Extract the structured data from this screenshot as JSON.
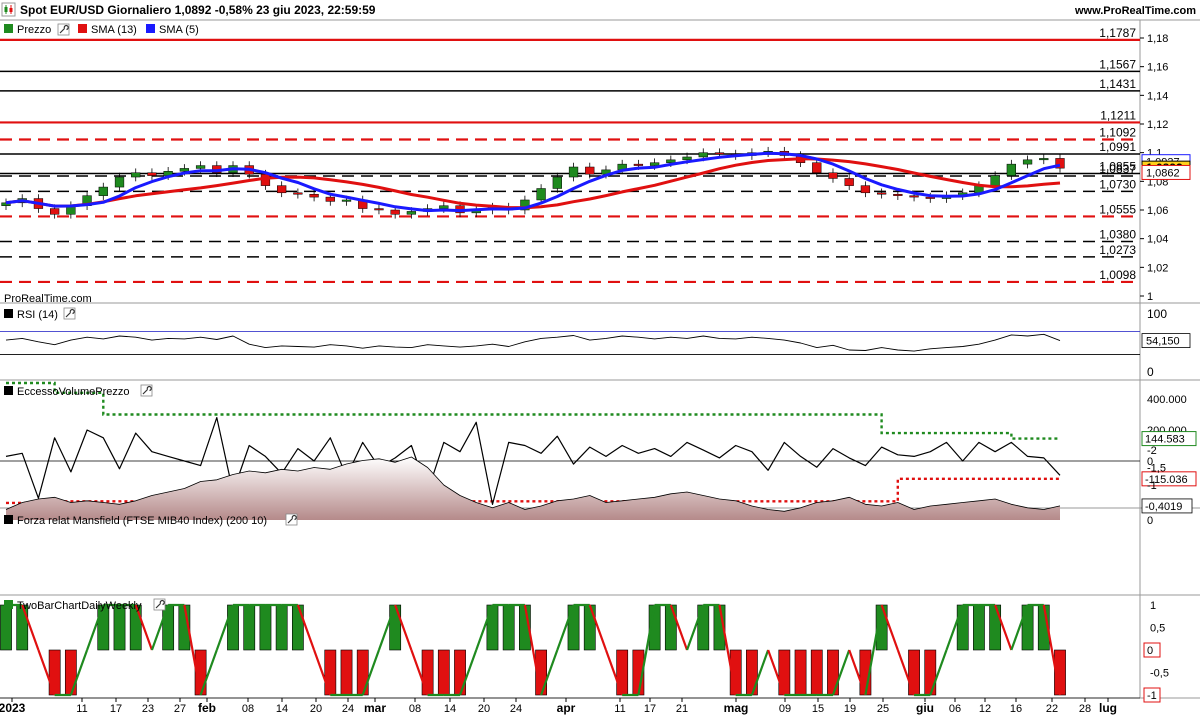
{
  "header": {
    "title": "Spot EUR/USD Giornaliero 1,0892 -0,58% 23 giu 2023, 22:59:59",
    "site": "www.ProRealTime.com"
  },
  "watermark": "ProRealTime.com",
  "colors": {
    "up": "#1f8a1f",
    "down": "#e01010",
    "sma13": "#e01010",
    "sma5": "#1a1aff",
    "support_red": "#e01010",
    "fill_pink": "#d9b3b3"
  },
  "chart_data": [
    {
      "type": "candlestick",
      "title": "Prezzo",
      "legend": [
        {
          "name": "Prezzo",
          "color": "#1f8a1f"
        },
        {
          "name": "SMA (13)",
          "color": "#e01010"
        },
        {
          "name": "SMA (5)",
          "color": "#1a1aff"
        }
      ],
      "x_labels": [
        "2023",
        "11",
        "17",
        "23",
        "27",
        "feb",
        "08",
        "14",
        "20",
        "24",
        "mar",
        "08",
        "14",
        "20",
        "24",
        "apr",
        "11",
        "17",
        "21",
        "mag",
        "09",
        "15",
        "19",
        "25",
        "giu",
        "06",
        "12",
        "16",
        "22",
        "28",
        "lug"
      ],
      "y_ticks": [
        "1,18",
        "1,16",
        "1,14",
        "1,12",
        "1,1",
        "1,08",
        "1,06",
        "1,04",
        "1,02",
        "1"
      ],
      "ylim": [
        1.0,
        1.18
      ],
      "close_path": [
        1.065,
        1.068,
        1.061,
        1.057,
        1.063,
        1.07,
        1.076,
        1.083,
        1.086,
        1.084,
        1.087,
        1.089,
        1.091,
        1.086,
        1.091,
        1.085,
        1.077,
        1.072,
        1.071,
        1.069,
        1.066,
        1.067,
        1.061,
        1.06,
        1.057,
        1.059,
        1.061,
        1.063,
        1.058,
        1.06,
        1.062,
        1.06,
        1.067,
        1.075,
        1.083,
        1.09,
        1.085,
        1.088,
        1.092,
        1.091,
        1.093,
        1.095,
        1.097,
        1.1,
        1.099,
        1.098,
        1.1,
        1.101,
        1.098,
        1.093,
        1.086,
        1.082,
        1.077,
        1.072,
        1.071,
        1.07,
        1.069,
        1.068,
        1.07,
        1.072,
        1.077,
        1.084,
        1.092,
        1.095,
        1.096,
        1.0892
      ],
      "levels": [
        {
          "label": "1,1787",
          "value": 1.1787,
          "style": "solid",
          "color": "#e01010",
          "label_color": "#e01010"
        },
        {
          "label": "1,1567",
          "value": 1.1567,
          "style": "solid",
          "color": "#000000",
          "label_color": "#000000"
        },
        {
          "label": "1,1431",
          "value": 1.1431,
          "style": "solid",
          "color": "#000000",
          "label_color": "#000000"
        },
        {
          "label": "1,1211",
          "value": 1.1211,
          "style": "solid",
          "color": "#e01010",
          "label_color": "#e01010"
        },
        {
          "label": "1,1092",
          "value": 1.1092,
          "style": "dash",
          "color": "#e01010",
          "label_color": "#e01010"
        },
        {
          "label": "1,0991",
          "value": 1.0991,
          "style": "solid",
          "color": "#000000",
          "label_color": "#000000"
        },
        {
          "label": "1,0855",
          "value": 1.0855,
          "style": "solid",
          "color": "#000000",
          "label_color": "#000000"
        },
        {
          "label": "1,0837",
          "value": 1.0837,
          "style": "dash",
          "color": "#000000",
          "label_color": "#000000"
        },
        {
          "label": "1,0730",
          "value": 1.073,
          "style": "dash",
          "color": "#000000",
          "label_color": "#000000"
        },
        {
          "label": "1,0555",
          "value": 1.0555,
          "style": "dash",
          "color": "#e01010",
          "label_color": "#e01010"
        },
        {
          "label": "1,0380",
          "value": 1.038,
          "style": "dash",
          "color": "#000000",
          "label_color": "#000000"
        },
        {
          "label": "1,0273",
          "value": 1.0273,
          "style": "dash",
          "color": "#000000",
          "label_color": "#000000"
        },
        {
          "label": "1,0098",
          "value": 1.0098,
          "style": "dash",
          "color": "#e01010",
          "label_color": "#e01010"
        }
      ],
      "badges": [
        {
          "label": "1,0937",
          "value": 1.0937,
          "color": "#1a1aff"
        },
        {
          "label": "1,0892",
          "value": 1.0892,
          "color": "#000000",
          "fill": "#ffd21a"
        },
        {
          "label": "1,0862",
          "value": 1.0862,
          "color": "#e01010"
        }
      ]
    },
    {
      "type": "line",
      "title": "RSI (14)",
      "y_ticks": [
        "100",
        "0"
      ],
      "ylim": [
        0,
        100
      ],
      "bands": [
        70,
        30
      ],
      "values": [
        55,
        58,
        52,
        47,
        55,
        60,
        57,
        62,
        60,
        55,
        58,
        57,
        60,
        56,
        62,
        48,
        42,
        45,
        44,
        43,
        47,
        45,
        41,
        45,
        43,
        42,
        47,
        45,
        43,
        45,
        48,
        44,
        52,
        58,
        60,
        63,
        55,
        58,
        62,
        60,
        57,
        60,
        58,
        62,
        58,
        57,
        60,
        58,
        55,
        50,
        42,
        46,
        38,
        37,
        42,
        38,
        36,
        40,
        42,
        44,
        48,
        55,
        64,
        62,
        65,
        54.15
      ],
      "badge": "54,150"
    },
    {
      "type": "line",
      "title": "EccessoVolumePrezzo",
      "y_ticks": [
        "400.000",
        "200.000",
        "0",
        "-92.182"
      ],
      "ylim": [
        -300000,
        460000
      ],
      "values": [
        30000,
        50000,
        -240000,
        150000,
        -70000,
        200000,
        150000,
        -50000,
        180000,
        60000,
        30000,
        0,
        -30000,
        280000,
        -200000,
        100000,
        30000,
        -80000,
        80000,
        0,
        150000,
        -100000,
        120000,
        -40000,
        20000,
        100000,
        -200000,
        120000,
        60000,
        250000,
        -280000,
        120000,
        100000,
        50000,
        160000,
        -20000,
        90000,
        30000,
        100000,
        50000,
        80000,
        30000,
        120000,
        70000,
        20000,
        100000,
        60000,
        -60000,
        120000,
        30000,
        -40000,
        80000,
        20000,
        -30000,
        90000,
        40000,
        30000,
        60000,
        120000,
        0,
        120000,
        60000,
        120000,
        30000,
        20000,
        -92182
      ],
      "upper_band": [
        600000,
        600000,
        600000,
        440000,
        440000,
        440000,
        300000,
        300000,
        300000,
        300000,
        300000,
        300000,
        300000,
        300000,
        300000,
        300000,
        300000,
        300000,
        300000,
        300000,
        300000,
        300000,
        300000,
        300000,
        300000,
        300000,
        300000,
        300000,
        300000,
        300000,
        300000,
        300000,
        300000,
        300000,
        300000,
        300000,
        300000,
        300000,
        300000,
        300000,
        300000,
        300000,
        300000,
        300000,
        300000,
        300000,
        300000,
        300000,
        300000,
        300000,
        300000,
        300000,
        300000,
        300000,
        180000,
        180000,
        180000,
        180000,
        180000,
        180000,
        180000,
        180000,
        144583,
        144583,
        144583,
        144583
      ],
      "lower_band": [
        -270000,
        -270000,
        -270000,
        -260000,
        -260000,
        -260000,
        -260000,
        -260000,
        -260000,
        -260000,
        -260000,
        -260000,
        -260000,
        -260000,
        -260000,
        -260000,
        -260000,
        -260000,
        -260000,
        -260000,
        -260000,
        -260000,
        -260000,
        -260000,
        -260000,
        -260000,
        -260000,
        -260000,
        -260000,
        -260000,
        -260000,
        -260000,
        -260000,
        -260000,
        -260000,
        -260000,
        -260000,
        -260000,
        -260000,
        -260000,
        -260000,
        -260000,
        -260000,
        -260000,
        -260000,
        -260000,
        -260000,
        -260000,
        -260000,
        -260000,
        -260000,
        -260000,
        -260000,
        -260000,
        -260000,
        -115036,
        -115036,
        -115036,
        -115036,
        -115036,
        -115036,
        -115036,
        -115036,
        -115036,
        -115036,
        -115036
      ],
      "badges": [
        {
          "label": "144.583",
          "value": 144583,
          "color": "#1f8a1f"
        },
        {
          "label": "-115.036",
          "value": -115036,
          "color": "#e01010"
        }
      ]
    },
    {
      "type": "area",
      "title": "Forza relat Mansfield (FTSE MIB40 Index) (200 10)",
      "y_ticks": [
        "0",
        "-1",
        "-1,5",
        "-2"
      ],
      "ylim": [
        -2.0,
        0.1
      ],
      "values": [
        -0.3,
        -0.5,
        -0.6,
        -0.65,
        -0.5,
        -0.55,
        -0.5,
        -0.45,
        -0.55,
        -0.7,
        -0.8,
        -0.9,
        -1.1,
        -1.15,
        -1.3,
        -1.4,
        -1.35,
        -1.45,
        -1.4,
        -1.5,
        -1.45,
        -1.6,
        -1.7,
        -1.75,
        -1.65,
        -1.8,
        -1.5,
        -1.0,
        -0.7,
        -0.5,
        -0.35,
        -0.5,
        -0.3,
        -0.4,
        -0.55,
        -0.6,
        -0.7,
        -0.5,
        -0.55,
        -0.6,
        -0.65,
        -0.75,
        -0.8,
        -0.7,
        -0.6,
        -0.55,
        -0.4,
        -0.3,
        -0.25,
        -0.35,
        -0.5,
        -0.55,
        -0.65,
        -0.45,
        -0.4,
        -0.5,
        -0.3,
        -0.4,
        -0.45,
        -0.5,
        -0.55,
        -0.6,
        -0.45,
        -0.35,
        -0.3,
        -0.4019
      ],
      "badge": "-0,4019"
    },
    {
      "type": "bar",
      "title": "TwoBarChartDailyWeekly",
      "y_ticks": [
        "1",
        "0,5",
        "0",
        "-0,5",
        "-1"
      ],
      "ylim": [
        -1.1,
        1.1
      ],
      "values": [
        1,
        1,
        0,
        -1,
        -1,
        0,
        1,
        1,
        1,
        0,
        1,
        1,
        -1,
        0,
        1,
        1,
        1,
        1,
        1,
        0,
        -1,
        -1,
        -1,
        0,
        1,
        0,
        -1,
        -1,
        -1,
        0,
        1,
        1,
        1,
        -1,
        0,
        1,
        1,
        0,
        -1,
        -1,
        1,
        1,
        0,
        1,
        1,
        -1,
        -1,
        0,
        -1,
        -1,
        -1,
        -1,
        0,
        -1,
        1,
        0,
        -1,
        -1,
        0,
        1,
        1,
        1,
        0,
        1,
        1,
        -1
      ],
      "badges": [
        {
          "label": "0",
          "value": 0,
          "color": "#e01010"
        },
        {
          "label": "-1",
          "value": -1,
          "color": "#e01010"
        }
      ]
    }
  ]
}
